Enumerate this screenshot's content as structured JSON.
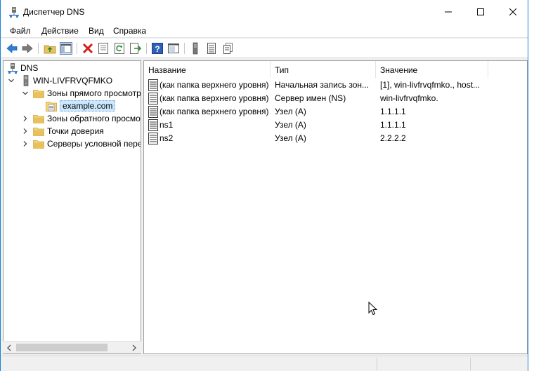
{
  "window": {
    "title": "Диспетчер DNS"
  },
  "menu": [
    "Файл",
    "Действие",
    "Вид",
    "Справка"
  ],
  "tree": [
    {
      "label": "DNS",
      "icon": "dns-server-icon"
    },
    {
      "label": "WIN-LIVFRVQFMKO",
      "icon": "server-icon",
      "expander": "expanded"
    },
    {
      "label": "Зоны прямого просмотра",
      "icon": "folder-icon",
      "expander": "expanded"
    },
    {
      "label": "example.com",
      "icon": "zone-icon",
      "selected": true
    },
    {
      "label": "Зоны обратного просмотра",
      "icon": "folder-icon",
      "expander": "collapsed"
    },
    {
      "label": "Точки доверия",
      "icon": "folder-icon",
      "expander": "collapsed"
    },
    {
      "label": "Серверы условной пересылки",
      "icon": "folder-icon",
      "expander": "collapsed"
    }
  ],
  "list": {
    "columns": [
      "Название",
      "Тип",
      "Значение"
    ],
    "rows": [
      {
        "name": "(как папка верхнего уровня)",
        "type": "Начальная запись зон...",
        "value": "[1], win-livfrvqfmko., host..."
      },
      {
        "name": "(как папка верхнего уровня)",
        "type": "Сервер имен (NS)",
        "value": "win-livfrvqfmko."
      },
      {
        "name": "(как папка верхнего уровня)",
        "type": "Узел (A)",
        "value": "1.1.1.1"
      },
      {
        "name": "ns1",
        "type": "Узел (A)",
        "value": "1.1.1.1"
      },
      {
        "name": "ns2",
        "type": "Узел (A)",
        "value": "2.2.2.2"
      }
    ]
  },
  "colors": {
    "accent": "#1883d7",
    "selection": "#cce8ff",
    "folder": "#e8c15a"
  }
}
